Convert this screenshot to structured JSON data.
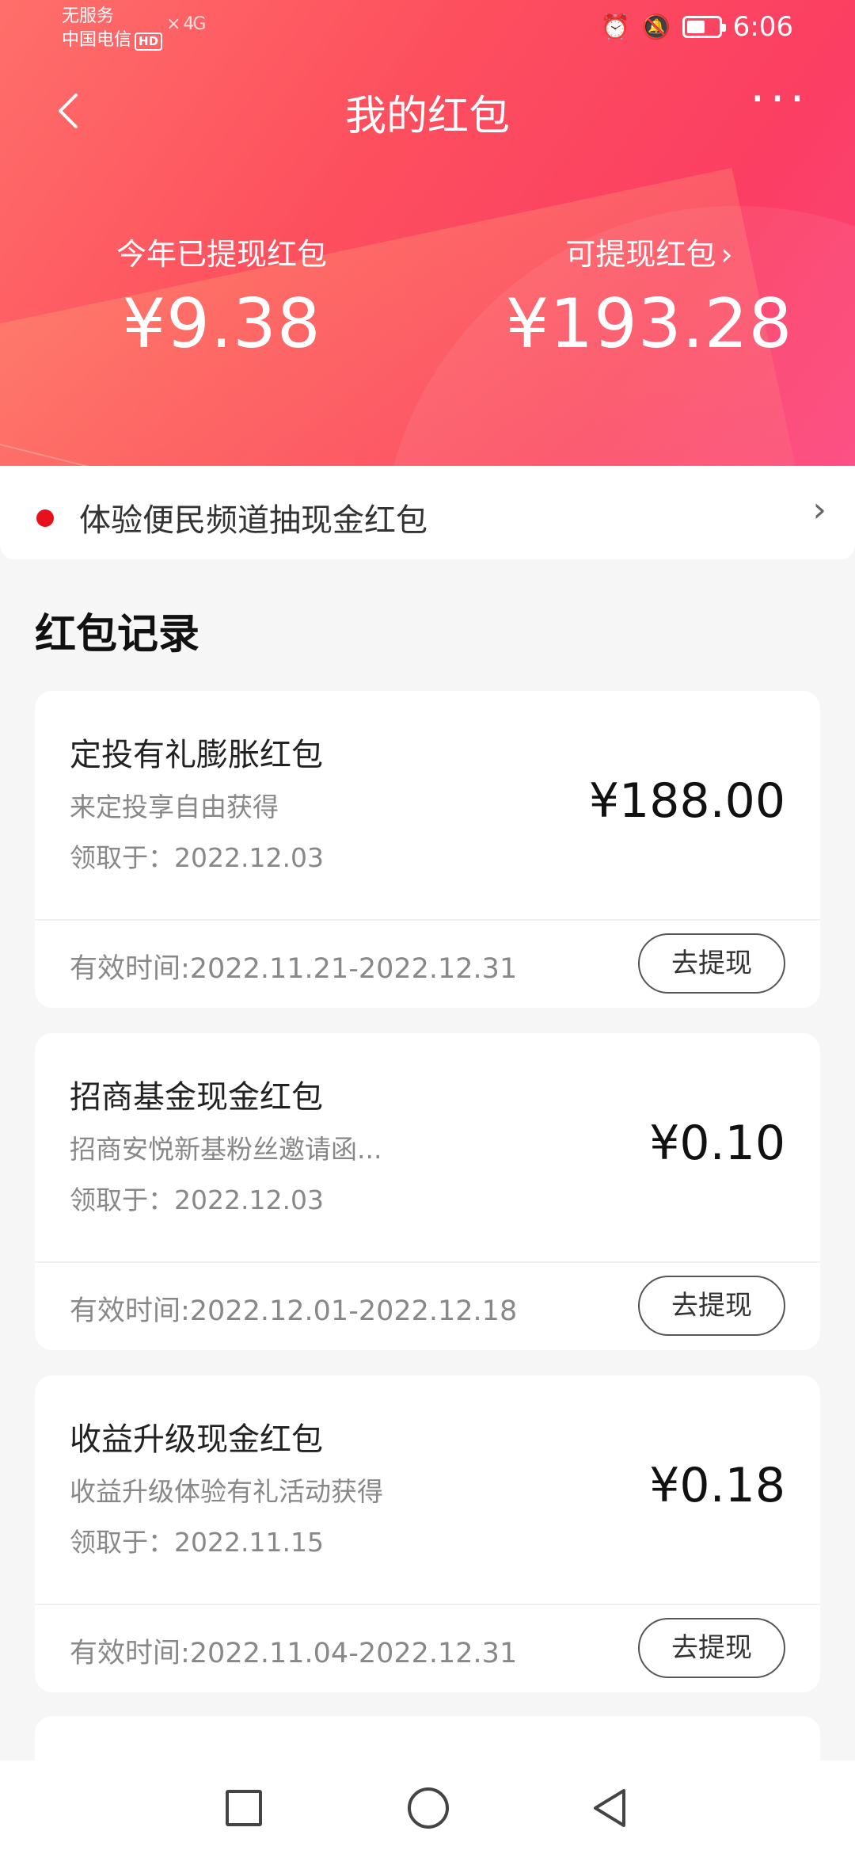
{
  "status_bar": {
    "line1": "无服务",
    "line2": "中国电信",
    "hd": "HD",
    "signal": "× 4G",
    "time": "6:06"
  },
  "header": {
    "title": "我的红包",
    "more": "···"
  },
  "stats": {
    "withdrawn_label": "今年已提现红包",
    "withdrawn_value": "¥9.38",
    "available_label": "可提现红包",
    "available_value": "¥193.28"
  },
  "promo": {
    "text": "体验便民频道抽现金红包"
  },
  "section_title": "红包记录",
  "withdraw_label": "去提现",
  "records": [
    {
      "name": "定投有礼膨胀红包",
      "desc": "来定投享自由获得",
      "received": "领取于：2022.12.03",
      "amount": "¥188.00",
      "valid": "有效时间:2022.11.21-2022.12.31"
    },
    {
      "name": "招商基金现金红包",
      "desc": "招商安悦新基粉丝邀请函...",
      "received": "领取于：2022.12.03",
      "amount": "¥0.10",
      "valid": "有效时间:2022.12.01-2022.12.18"
    },
    {
      "name": "收益升级现金红包",
      "desc": "收益升级体验有礼活动获得",
      "received": "领取于：2022.11.15",
      "amount": "¥0.18",
      "valid": "有效时间:2022.11.04-2022.12.31"
    }
  ],
  "colors": {
    "accent": "#fb4a60",
    "dot": "#e8101c"
  }
}
